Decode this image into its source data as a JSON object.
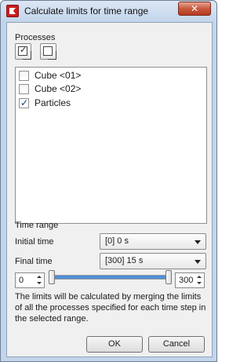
{
  "window": {
    "title": "Calculate limits for time range",
    "close_glyph": "✕",
    "icon": "app-logo-icon"
  },
  "processes": {
    "heading": "Processes",
    "check_all_icon": "check-all-icon",
    "uncheck_all_icon": "uncheck-all-icon",
    "items": [
      {
        "label": "Cube <01>",
        "checked": false
      },
      {
        "label": "Cube <02>",
        "checked": false
      },
      {
        "label": "Particles",
        "checked": true
      }
    ]
  },
  "time_range": {
    "heading": "Time range",
    "initial_label": "Initial time",
    "initial_value": "[0] 0 s",
    "final_label": "Final time",
    "final_value": "[300] 15 s",
    "min_value": "0",
    "max_value": "300",
    "range_min": 0,
    "range_max": 300,
    "range_start": 0,
    "range_end": 300,
    "accent_color": "#4d8fd8"
  },
  "description": "The limits will be calculated by merging the limits of all the processes specified for each time step in the selected range.",
  "buttons": {
    "ok": "OK",
    "cancel": "Cancel"
  }
}
